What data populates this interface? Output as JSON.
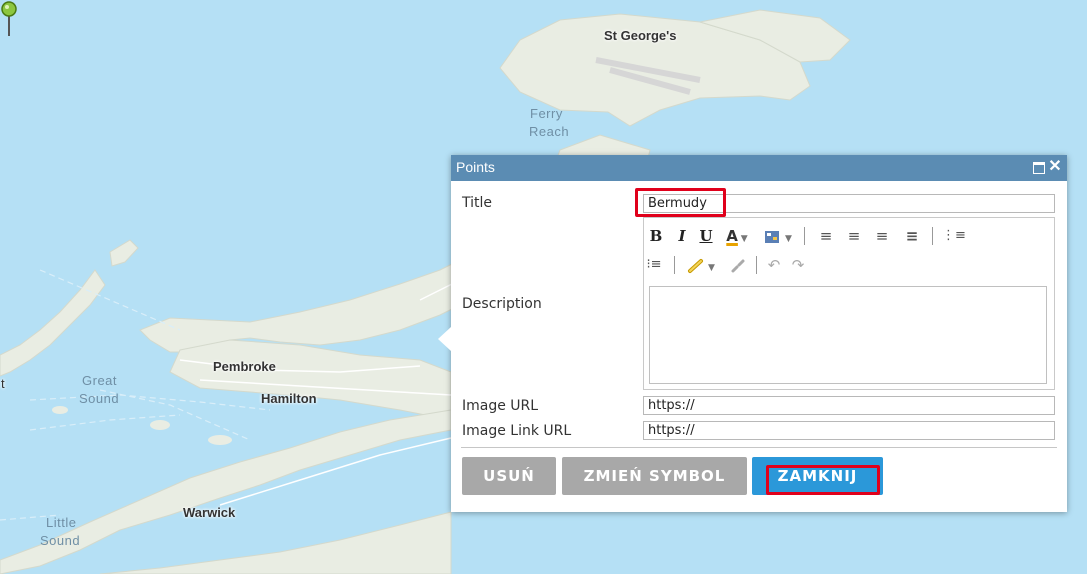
{
  "map": {
    "places": {
      "st_georges": "St George's",
      "ferry_reach": [
        "Ferry",
        "Reach"
      ],
      "pembroke": "Pembroke",
      "hamilton": "Hamilton",
      "great_sound": [
        "Great",
        "Sound"
      ],
      "warwick": "Warwick",
      "little_sound": [
        "Little",
        "Sound"
      ],
      "edge_t": "t"
    },
    "colors": {
      "water": "#b5e0f5",
      "land": "#e9ede3",
      "road": "#ffffff"
    }
  },
  "popup": {
    "title": "Points",
    "icons": {
      "maximize": "maximize-icon",
      "close": "close-icon"
    },
    "close_glyph": "✕",
    "fields": {
      "title_label": "Title",
      "title_value": "Bermudy",
      "description_label": "Description",
      "image_url_label": "Image URL",
      "image_url_value": "https://",
      "image_link_url_label": "Image Link URL",
      "image_link_url_value": "https://"
    },
    "toolbar": {
      "bold": "B",
      "italic": "I",
      "underline": "U",
      "font_color": "A",
      "icons": [
        "bold-icon",
        "italic-icon",
        "underline-icon",
        "font-color-icon",
        "highlight-icon",
        "align-left-icon",
        "align-center-icon",
        "align-right-icon",
        "justify-icon",
        "numbered-list-icon",
        "bulleted-list-icon",
        "link-icon",
        "unlink-icon",
        "undo-icon",
        "redo-icon"
      ]
    },
    "buttons": {
      "delete": "USUŃ",
      "change_symbol": "ZMIEŃ SYMBOL",
      "close": "ZAMKNIJ"
    },
    "colors": {
      "titlebar": "#5b8cb3",
      "primary": "#2b98d9",
      "secondary": "#a8a8a8",
      "highlight": "#e0001b"
    }
  }
}
